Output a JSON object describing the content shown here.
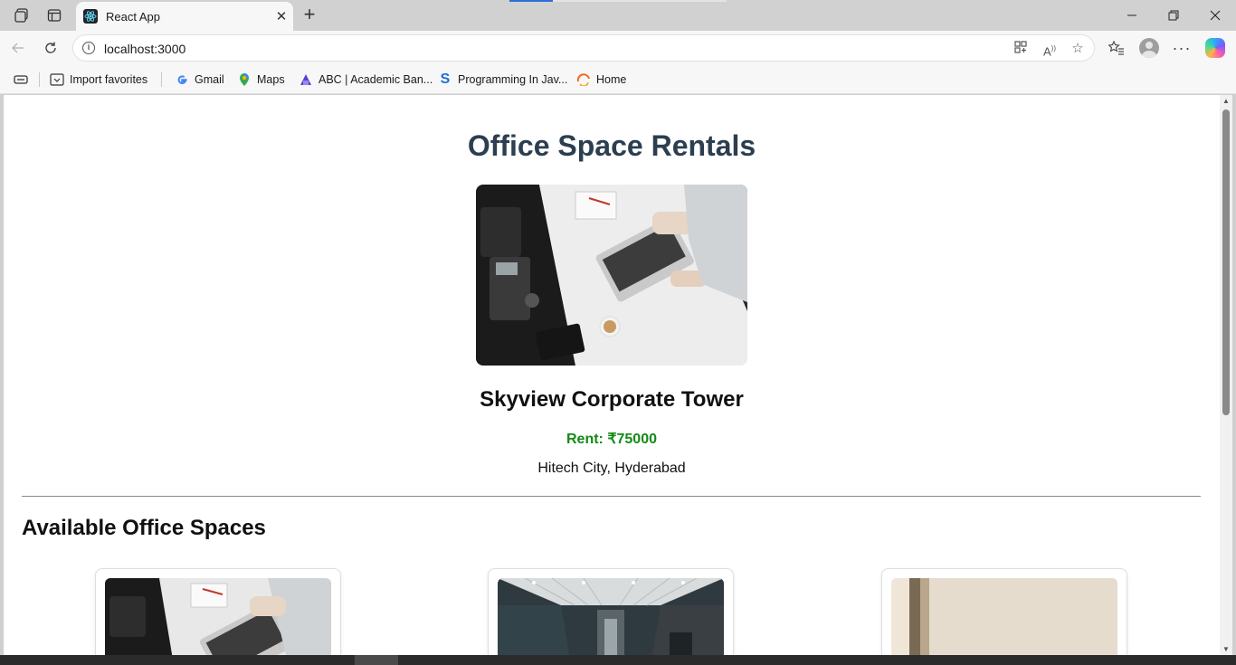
{
  "browser": {
    "tab_title": "React App",
    "url": "localhost:3000",
    "favorites": [
      {
        "label": "Import favorites",
        "icon": "import-favorites-icon"
      },
      {
        "label": "Gmail",
        "icon": "google-icon"
      },
      {
        "label": "Maps",
        "icon": "maps-pin-icon"
      },
      {
        "label": "ABC | Academic Ban...",
        "icon": "abc-icon"
      },
      {
        "label": "Programming In Jav...",
        "icon": "swayam-icon"
      },
      {
        "label": "Home",
        "icon": "home-swirl-icon"
      }
    ]
  },
  "page": {
    "title": "Office Space Rentals",
    "featured": {
      "name": "Skyview Corporate Tower",
      "rent": "Rent: ₹75000",
      "address": "Hitech City, Hyderabad"
    },
    "section_title": "Available Office Spaces"
  },
  "colors": {
    "title": "#2c3e50",
    "rent": "#138a13",
    "accent": "#2b6fd6"
  }
}
